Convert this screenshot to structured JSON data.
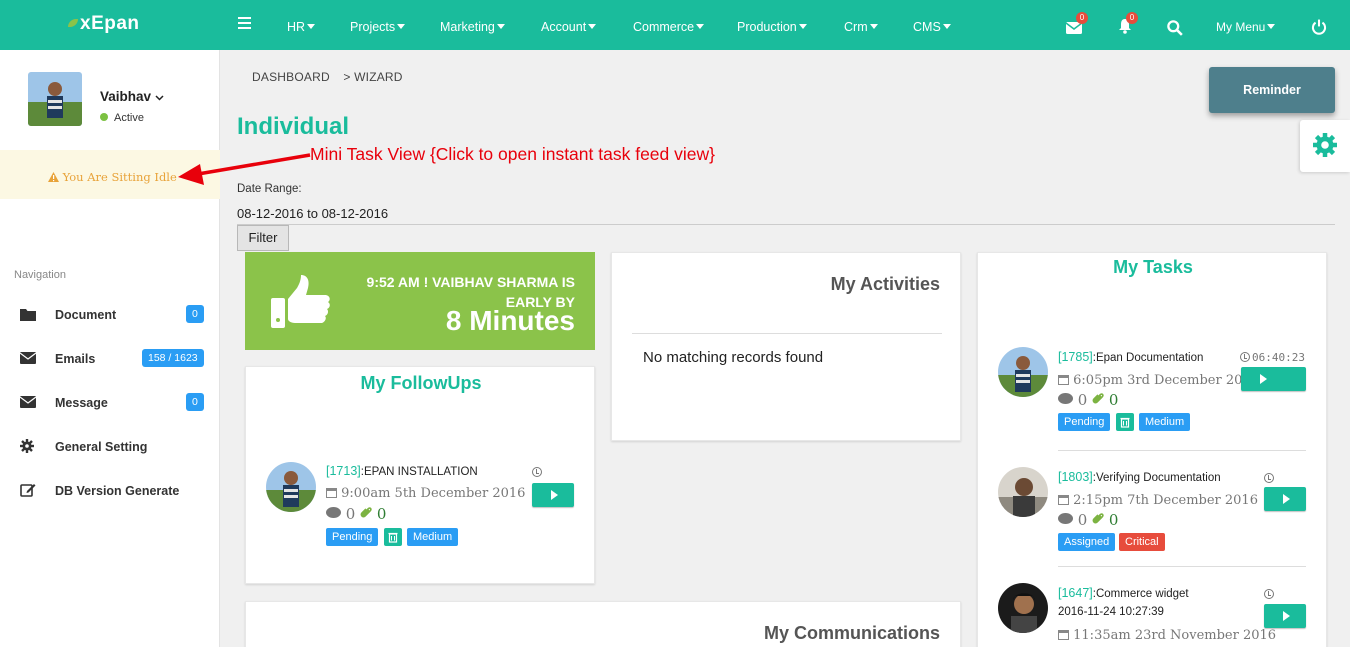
{
  "app": {
    "logo": "xEpan"
  },
  "topnav": {
    "menus": [
      "HR",
      "Projects",
      "Marketing",
      "Account",
      "Commerce",
      "Production",
      "Crm",
      "CMS"
    ],
    "mail_count": "0",
    "bell_count": "0",
    "my_menu": "My Menu"
  },
  "sidebar": {
    "user_name": "Vaibhav",
    "user_status": "Active",
    "idle_message": "You Are Sitting Idle",
    "nav_heading": "Navigation",
    "items": [
      {
        "label": "Document",
        "icon": "folder-icon",
        "badge": "0"
      },
      {
        "label": "Emails",
        "icon": "envelope-icon",
        "badge": "158 / 1623"
      },
      {
        "label": "Message",
        "icon": "envelope-icon",
        "badge": "0"
      },
      {
        "label": "General Setting",
        "icon": "gear-icon",
        "badge": ""
      },
      {
        "label": "DB Version Generate",
        "icon": "edit-icon",
        "badge": ""
      }
    ]
  },
  "breadcrumb": {
    "first": "DASHBOARD",
    "second": "WIZARD"
  },
  "reminder_label": "Reminder",
  "page_title": "Individual",
  "annotation": "Mini Task View {Click to open instant task feed view}",
  "filter": {
    "label": "Date Range:",
    "value": "08-12-2016 to 08-12-2016",
    "button": "Filter"
  },
  "attendance": {
    "line1": "9:52 AM ! VAIBHAV SHARMA IS EARLY BY",
    "big": "8 Minutes"
  },
  "followups": {
    "title": "My FollowUps",
    "item": {
      "id": "[1713]",
      "title": ":EPAN INSTALLATION",
      "date": "9:00am 5th December 2016",
      "comments": "0",
      "attachments": "0",
      "status": "Pending",
      "priority": "Medium"
    }
  },
  "activities": {
    "title": "My Activities",
    "empty": "No matching records found"
  },
  "communications": {
    "title": "My Communications"
  },
  "tasks": {
    "title": "My Tasks",
    "items": [
      {
        "id": "[1785]",
        "title": ":Epan Documentation",
        "timer": "06:40:23",
        "date": "6:05pm 3rd December 2016",
        "comments": "0",
        "attachments": "0",
        "status": "Pending",
        "priority": "Medium"
      },
      {
        "id": "[1803]",
        "title": ":Verifying Documentation",
        "timer": "",
        "date": "2:15pm 7th December 2016",
        "comments": "0",
        "attachments": "0",
        "status": "Assigned",
        "priority": "Critical"
      },
      {
        "id": "[1647]",
        "title": ":Commerce widget",
        "timer": "",
        "created": "2016-11-24 10:27:39",
        "date": "11:35am 23rd November 2016"
      }
    ]
  },
  "colors": {
    "brand": "#1abc9c",
    "success": "#8bc34a",
    "info": "#2a9df4",
    "danger": "#e74c3c",
    "annotation": "#e8000b"
  }
}
